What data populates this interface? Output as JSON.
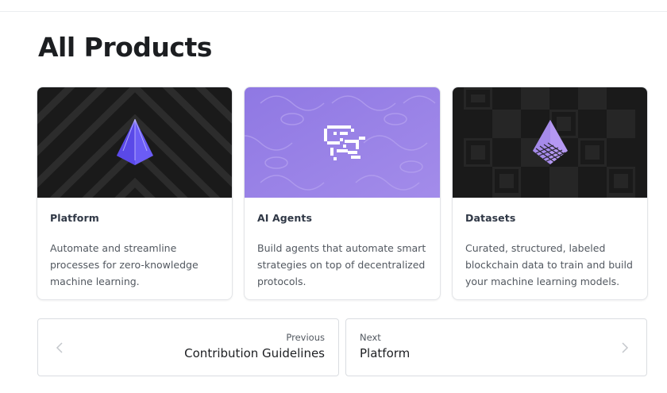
{
  "page": {
    "title": "All Products"
  },
  "products": [
    {
      "name": "Platform",
      "description": "Automate and streamline processes for zero-knowledge machine learning.",
      "image_icon": "pyramid-icon",
      "image_bg": "#1b1b1b",
      "accent": "#6b5cf5"
    },
    {
      "name": "AI Agents",
      "description": "Build agents that automate smart strategies on top of decentralized protocols.",
      "image_icon": "pixel-ornament-icon",
      "image_bg": "#9a80e6",
      "accent": "#ffffff"
    },
    {
      "name": "Datasets",
      "description": "Curated, structured, labeled blockchain data to train and build your machine learning models.",
      "image_icon": "grid-pyramid-icon",
      "image_bg": "#1b1b1b",
      "accent": "#b598f2"
    }
  ],
  "pagination": {
    "previous": {
      "sub_label": "Previous",
      "label": "Contribution Guidelines"
    },
    "next": {
      "sub_label": "Next",
      "label": "Platform"
    }
  }
}
